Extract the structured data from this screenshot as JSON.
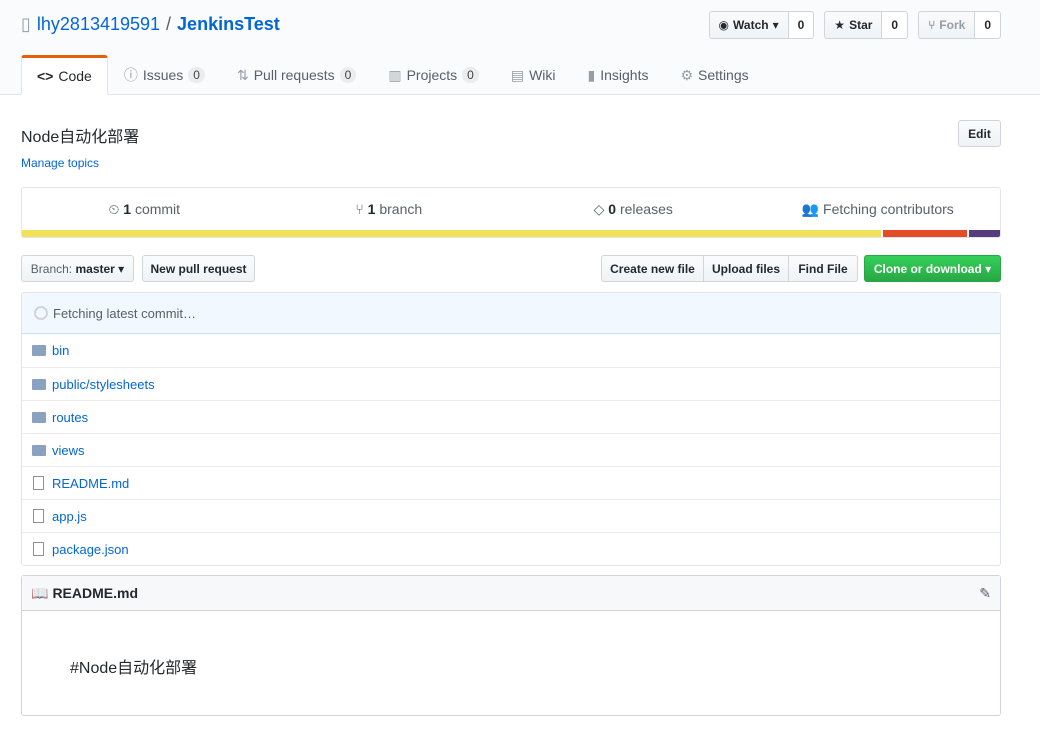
{
  "repo": {
    "owner": "lhy2813419591",
    "separator": "/",
    "name": "JenkinsTest"
  },
  "actions": [
    {
      "label": "Watch",
      "count": "0",
      "icon": "eye-icon"
    },
    {
      "label": "Star",
      "count": "0",
      "icon": "star-icon"
    },
    {
      "label": "Fork",
      "count": "0",
      "icon": "fork-icon"
    }
  ],
  "tabs": [
    {
      "label": "Code",
      "icon": "code-icon"
    },
    {
      "label": "Issues",
      "count": "0",
      "icon": "issue-icon"
    },
    {
      "label": "Pull requests",
      "count": "0",
      "icon": "pr-icon"
    },
    {
      "label": "Projects",
      "count": "0",
      "icon": "project-icon"
    },
    {
      "label": "Wiki",
      "icon": "book-icon"
    },
    {
      "label": "Insights",
      "icon": "graph-icon"
    },
    {
      "label": "Settings",
      "icon": "gear-icon"
    }
  ],
  "description": "Node自动化部署",
  "edit_label": "Edit",
  "manage_topics": "Manage topics",
  "summary": {
    "commits_n": "1",
    "commits": "commit",
    "branches_n": "1",
    "branches": "branch",
    "releases_n": "0",
    "releases": "releases",
    "contributors": "Fetching contributors"
  },
  "languages": [
    {
      "color": "#f1e05a",
      "fraction": 0.882
    },
    {
      "color": "#e34c26",
      "fraction": 0.086
    },
    {
      "color": "#563d7c",
      "fraction": 0.032
    }
  ],
  "toolbar": {
    "branch_label": "Branch:",
    "branch": "master",
    "new_pr": "New pull request",
    "create": "Create new file",
    "upload": "Upload files",
    "find": "Find File",
    "clone": "Clone or download"
  },
  "commit_status": "Fetching latest commit…",
  "files": [
    {
      "name": "bin",
      "type": "dir"
    },
    {
      "name": "public/stylesheets",
      "type": "dir"
    },
    {
      "name": "routes",
      "type": "dir"
    },
    {
      "name": "views",
      "type": "dir"
    },
    {
      "name": "README.md",
      "type": "file"
    },
    {
      "name": "app.js",
      "type": "file"
    },
    {
      "name": "package.json",
      "type": "file"
    }
  ],
  "readme": {
    "title": "README.md",
    "content": "#Node自动化部署"
  }
}
